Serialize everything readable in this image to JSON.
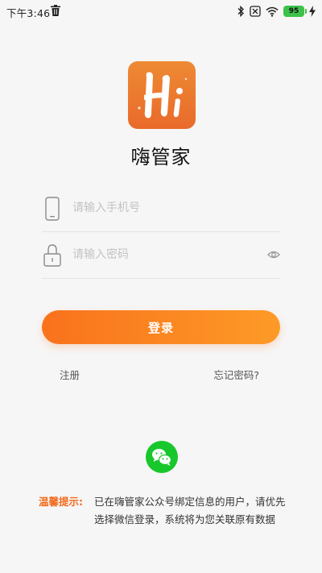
{
  "status_bar": {
    "time": "下午3:46",
    "battery": "95",
    "icons": [
      "trash-icon",
      "bluetooth-icon",
      "mute-icon",
      "wifi-icon",
      "battery-icon",
      "charging-icon"
    ]
  },
  "app": {
    "logo_text": "Hi",
    "name": "嗨管家"
  },
  "form": {
    "phone_placeholder": "请输入手机号",
    "password_placeholder": "请输入密码",
    "login_label": "登录",
    "register_label": "注册",
    "forgot_label": "忘记密码?"
  },
  "tip": {
    "label": "温馨提示:",
    "text": "已在嗨管家公众号绑定信息的用户，请优先选择微信登录，系统将为您关联原有数据"
  },
  "colors": {
    "accent": "#f9721c",
    "accent_light": "#fd9a27",
    "wechat": "#18c72b",
    "tip": "#f26a1b",
    "battery": "#3cc24a"
  }
}
